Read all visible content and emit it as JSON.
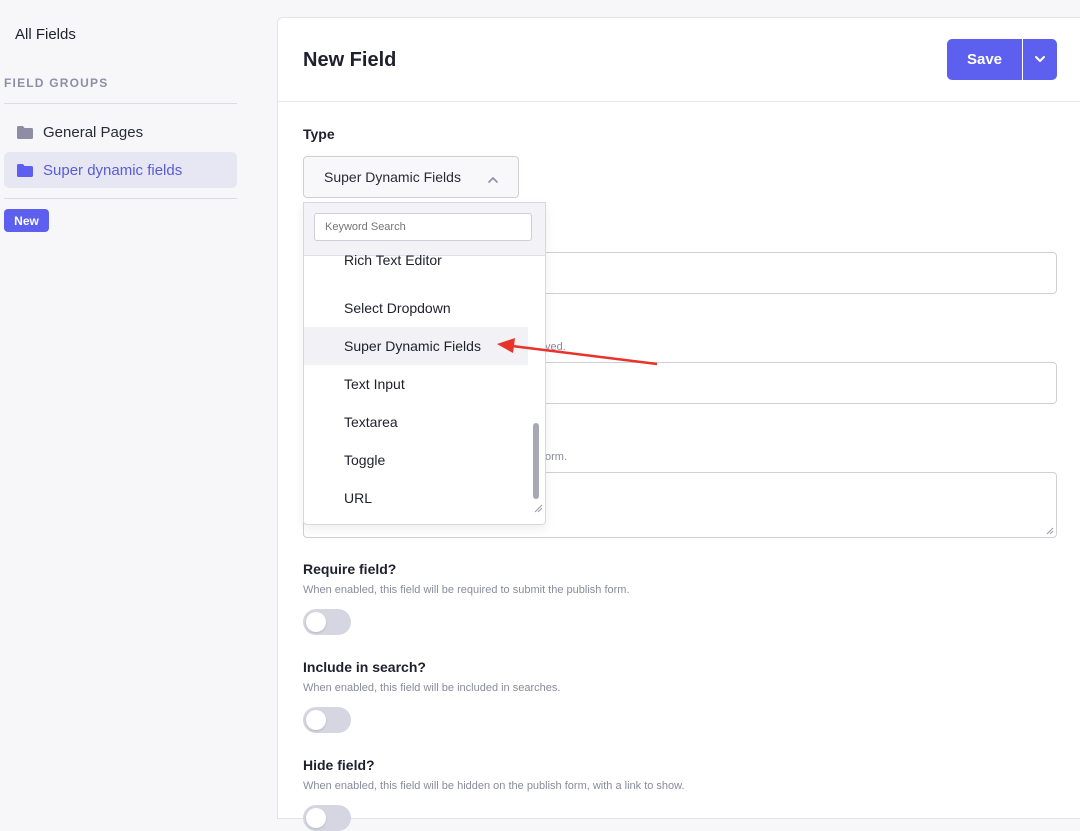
{
  "sidebar": {
    "all_fields": "All Fields",
    "heading": "FIELD GROUPS",
    "groups": [
      {
        "label": "General Pages",
        "active": false
      },
      {
        "label": "Super dynamic fields",
        "active": true
      }
    ],
    "new_label": "New"
  },
  "header": {
    "title": "New Field",
    "save_label": "Save"
  },
  "form": {
    "type_label": "Type",
    "type_value": "Super Dynamic Fields",
    "help_partial_1": "ved.",
    "help_partial_2": "orm.",
    "require": {
      "label": "Require field?",
      "help": "When enabled, this field will be required to submit the publish form."
    },
    "search": {
      "label": "Include in search?",
      "help": "When enabled, this field will be included in searches."
    },
    "hide": {
      "label": "Hide field?",
      "help": "When enabled, this field will be hidden on the publish form, with a link to show."
    }
  },
  "dropdown": {
    "search_placeholder": "Keyword Search",
    "items": [
      {
        "label": "Rich Text Editor"
      },
      {
        "label": "Select Dropdown"
      },
      {
        "label": "Super Dynamic Fields",
        "highlighted": true
      },
      {
        "label": "Text Input"
      },
      {
        "label": "Textarea"
      },
      {
        "label": "Toggle"
      },
      {
        "label": "URL"
      }
    ]
  },
  "colors": {
    "accent": "#5d5fef",
    "annotation_arrow": "#e8332a"
  }
}
